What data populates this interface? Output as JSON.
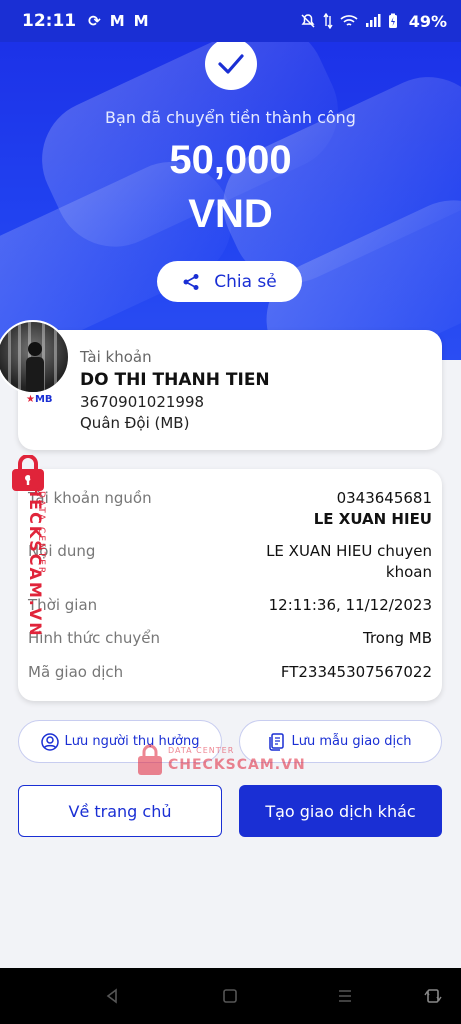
{
  "status_bar": {
    "time": "12:11",
    "battery": "49%"
  },
  "success_message": "Bạn đã chuyển tiền thành công",
  "amount": "50,000",
  "currency": "VND",
  "share_label": "Chia sẻ",
  "recipient": {
    "label": "Tài khoản",
    "name": "DO THI THANH TIEN",
    "account": "3670901021998",
    "bank": "Quân Đội (MB)",
    "bank_logo": "MB"
  },
  "details": [
    {
      "key": "Tài khoản nguồn",
      "value": "0343645681",
      "value2": "LE XUAN HIEU"
    },
    {
      "key": "Nội dung",
      "value": "LE XUAN HIEU chuyen",
      "value2": "khoan"
    },
    {
      "key": "Thời gian",
      "value": "12:11:36, 11/12/2023"
    },
    {
      "key": "Hình thức chuyển",
      "value": "Trong MB"
    },
    {
      "key": "Mã giao dịch",
      "value": "FT23345307567022"
    }
  ],
  "save_beneficiary": "Lưu người thụ hưởng",
  "save_template": "Lưu mẫu giao dịch",
  "home_button": "Về trang chủ",
  "new_transaction_button": "Tạo giao dịch khác",
  "watermark": {
    "text": "CHECKSCAM.VN",
    "subtext": "DATA CENTER"
  },
  "colors": {
    "primary": "#1a2fd4",
    "watermark": "#e0243a"
  }
}
